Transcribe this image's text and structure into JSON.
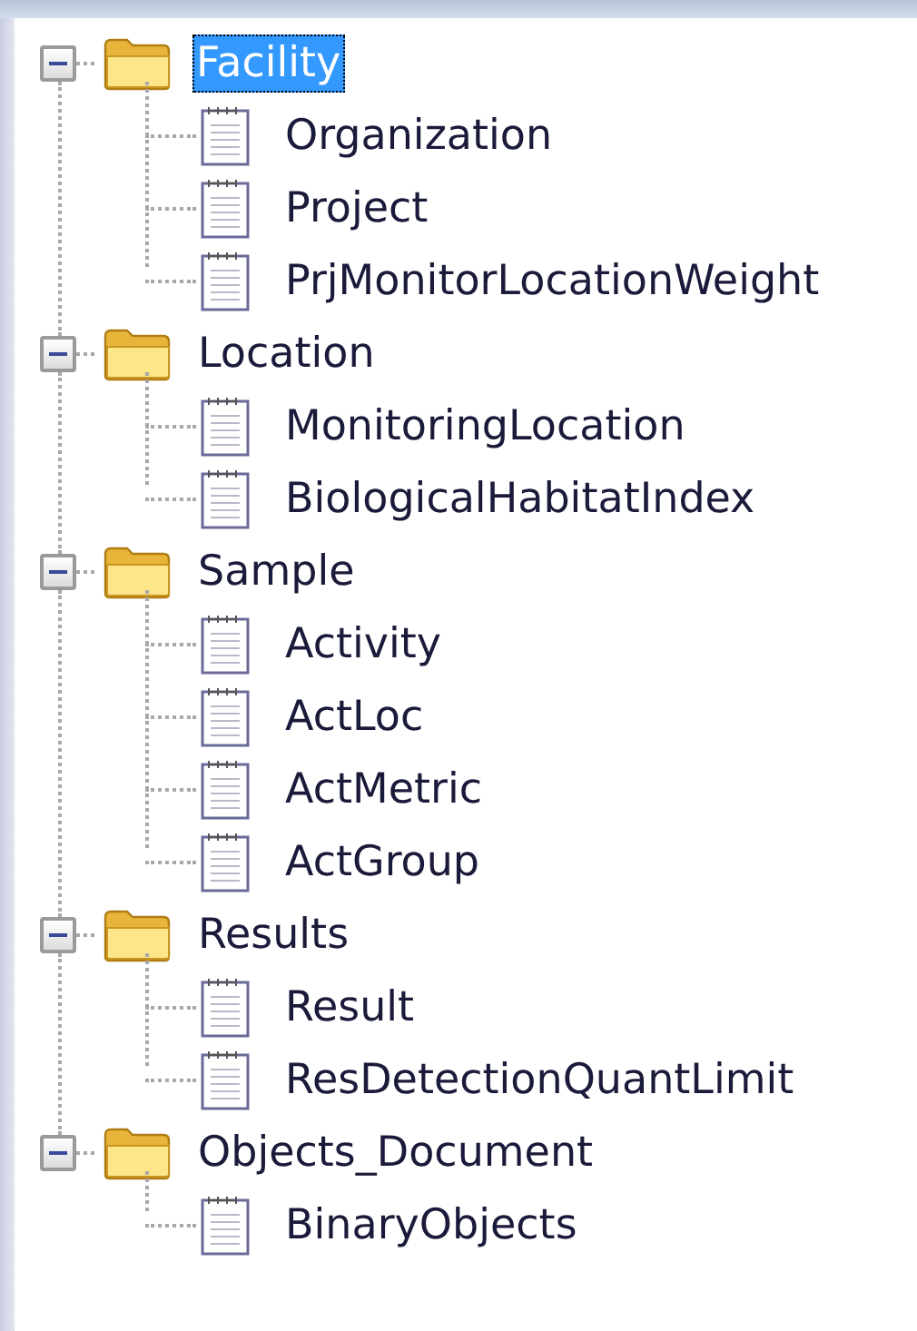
{
  "tree": [
    {
      "label": "Facility",
      "expanded": true,
      "selected": true,
      "children": [
        {
          "label": "Organization",
          "selected": false
        },
        {
          "label": "Project",
          "selected": false
        },
        {
          "label": "PrjMonitorLocationWeight",
          "selected": false
        }
      ]
    },
    {
      "label": "Location",
      "expanded": true,
      "selected": false,
      "children": [
        {
          "label": "MonitoringLocation",
          "selected": false
        },
        {
          "label": "BiologicalHabitatIndex",
          "selected": false
        }
      ]
    },
    {
      "label": "Sample",
      "expanded": true,
      "selected": false,
      "children": [
        {
          "label": "Activity",
          "selected": false
        },
        {
          "label": "ActLoc",
          "selected": false
        },
        {
          "label": "ActMetric",
          "selected": false
        },
        {
          "label": "ActGroup",
          "selected": false
        }
      ]
    },
    {
      "label": "Results",
      "expanded": true,
      "selected": false,
      "children": [
        {
          "label": "Result",
          "selected": false
        },
        {
          "label": "ResDetectionQuantLimit",
          "selected": false
        }
      ]
    },
    {
      "label": "Objects_Document",
      "expanded": true,
      "selected": false,
      "children": [
        {
          "label": "BinaryObjects",
          "selected": false
        }
      ]
    }
  ]
}
